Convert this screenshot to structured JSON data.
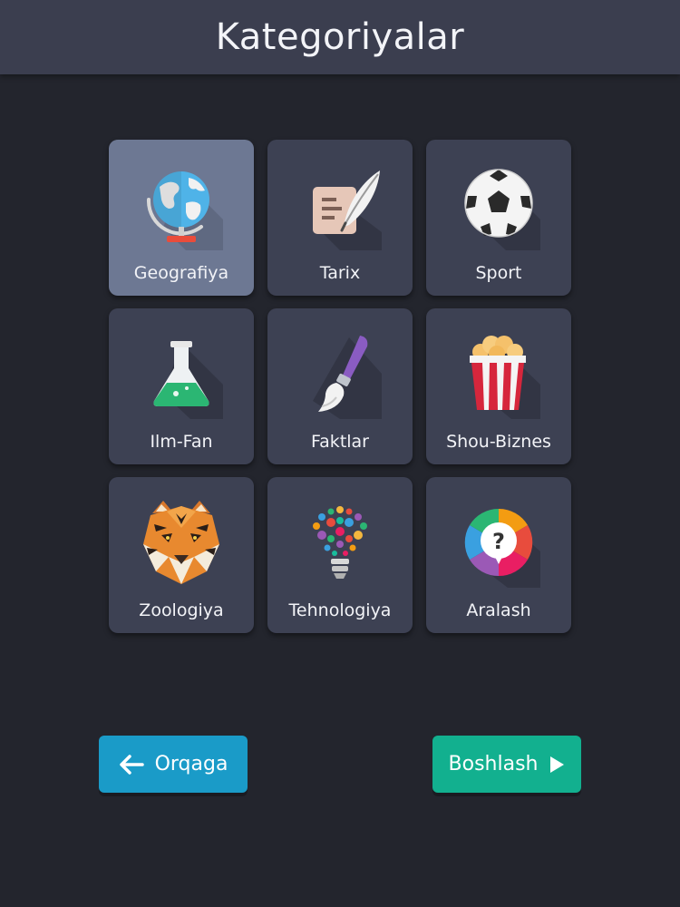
{
  "header": {
    "title": "Kategoriyalar"
  },
  "categories": [
    {
      "label": "Geografiya",
      "icon": "globe-icon",
      "selected": true
    },
    {
      "label": "Tarix",
      "icon": "scroll-quill-icon",
      "selected": false
    },
    {
      "label": "Sport",
      "icon": "soccer-ball-icon",
      "selected": false
    },
    {
      "label": "Ilm-Fan",
      "icon": "flask-icon",
      "selected": false
    },
    {
      "label": "Faktlar",
      "icon": "paintbrush-icon",
      "selected": false
    },
    {
      "label": "Shou-Biznes",
      "icon": "popcorn-icon",
      "selected": false
    },
    {
      "label": "Zoologiya",
      "icon": "tiger-icon",
      "selected": false
    },
    {
      "label": "Tehnologiya",
      "icon": "lightbulb-icon",
      "selected": false
    },
    {
      "label": "Aralash",
      "icon": "question-wheel-icon",
      "selected": false
    }
  ],
  "buttons": {
    "back_label": "Orqaga",
    "start_label": "Boshlash"
  },
  "colors": {
    "background": "#23252d",
    "header": "#3b3e4f",
    "card": "#3d4153",
    "card_selected": "#6d7893",
    "back_button": "#1a9bc8",
    "start_button": "#12b08f"
  }
}
